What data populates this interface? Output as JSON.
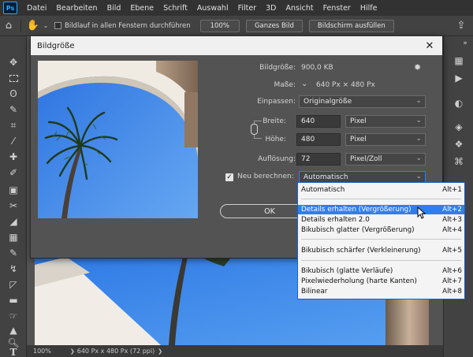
{
  "menubar": {
    "logo": "Ps",
    "items": [
      "Datei",
      "Bearbeiten",
      "Bild",
      "Ebene",
      "Schrift",
      "Auswahl",
      "Filter",
      "3D",
      "Ansicht",
      "Fenster",
      "Hilfe"
    ]
  },
  "options": {
    "scroll_all_label": "Bildlauf in allen Fenstern durchführen",
    "zoom_btn": "100%",
    "fit_btn": "Ganzes Bild",
    "fill_btn": "Bildschirm ausfüllen"
  },
  "dialog": {
    "title": "Bildgröße",
    "image_size_label": "Bildgröße:",
    "image_size_value": "900,0 KB",
    "dimensions_label": "Maße:",
    "dimensions_value": "640 Px × 480 Px",
    "fit_label": "Einpassen:",
    "fit_value": "Originalgröße",
    "width_label": "Breite:",
    "width_value": "640",
    "width_unit": "Pixel",
    "height_label": "Höhe:",
    "height_value": "480",
    "height_unit": "Pixel",
    "resolution_label": "Auflösung:",
    "resolution_value": "72",
    "resolution_unit": "Pixel/Zoll",
    "resample_label": "Neu berechnen:",
    "resample_value": "Automatisch",
    "ok_label": "OK"
  },
  "dropdown": {
    "items": [
      {
        "label": "Automatisch",
        "key": "Alt+1"
      },
      {
        "label": "Details erhalten (Vergrößerung)",
        "key": "Alt+2"
      },
      {
        "label": "Details erhalten 2.0",
        "key": "Alt+3"
      },
      {
        "label": "Bikubisch glatter (Vergrößerung)",
        "key": "Alt+4"
      },
      {
        "label": "Bikubisch schärfer (Verkleinerung)",
        "key": "Alt+5"
      },
      {
        "label": "Bikubisch (glatte Verläufe)",
        "key": "Alt+6"
      },
      {
        "label": "Pixelwiederholung (harte Kanten)",
        "key": "Alt+7"
      },
      {
        "label": "Bilinear",
        "key": "Alt+8"
      }
    ]
  },
  "status": {
    "zoom": "100%",
    "doc_info": "640 Px x 480 Px (72 ppi)"
  }
}
